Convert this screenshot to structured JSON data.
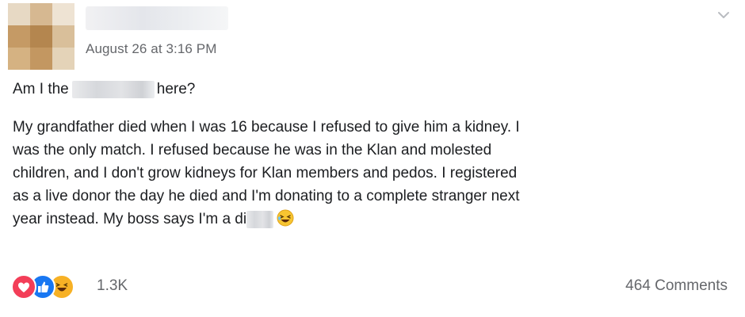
{
  "post": {
    "author_name": "",
    "timestamp": "August 26 at 3:16 PM",
    "title_before": "Am I the",
    "title_after": "here?",
    "lines": [
      "My grandfather died when I was 16 because I refused to give him a kidney. I",
      "was the only match. I refused because he was in the Klan and molested",
      "children, and I don't grow kidneys for Klan members and pedos. I registered",
      "as a live donor the day he died and I'm donating to a complete stranger next",
      "year instead. My boss says I'm a di"
    ],
    "reactions": {
      "types": [
        "love",
        "like",
        "haha"
      ],
      "count": "1.3K"
    },
    "comments_label": "464 Comments"
  },
  "colors": {
    "love": "#f33e58",
    "like": "#1877f2",
    "haha": "#f7b125",
    "secondary_text": "#65676b"
  },
  "icons": {
    "options": "chevron-down-icon",
    "emoji": "laughing-emoji-icon"
  }
}
